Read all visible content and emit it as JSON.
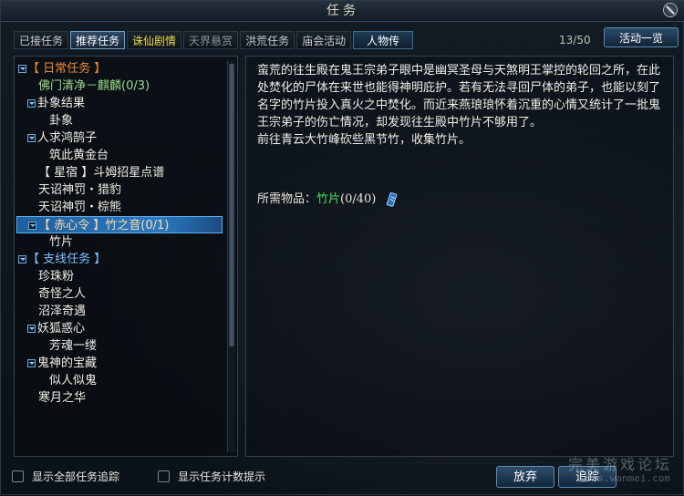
{
  "window": {
    "title": "任务"
  },
  "tabs": [
    {
      "label": "已接任务",
      "state": "normal"
    },
    {
      "label": "推荐任务",
      "state": "active"
    },
    {
      "label": "诛仙剧情",
      "state": "gold"
    },
    {
      "label": "天界悬赏",
      "state": "dim"
    },
    {
      "label": "洪荒任务",
      "state": "normal"
    },
    {
      "label": "庙会活动",
      "state": "normal"
    },
    {
      "label": "人物传",
      "state": "highlight"
    }
  ],
  "counter": "13/50",
  "activity_button": "活动一览",
  "tree": [
    {
      "label": "【 日常任务 】",
      "level": 0,
      "toggle": true,
      "color": "orange"
    },
    {
      "label": "佛门清净－麒麟(0/3)",
      "level": 1,
      "toggle": false,
      "color": "green"
    },
    {
      "label": "卦象结果",
      "level": 1,
      "toggle": true,
      "color": "white"
    },
    {
      "label": "卦象",
      "level": 2,
      "toggle": false,
      "color": "white"
    },
    {
      "label": "人求鸿鹄子",
      "level": 1,
      "toggle": true,
      "color": "white"
    },
    {
      "label": "筑此黄金台",
      "level": 2,
      "toggle": false,
      "color": "white"
    },
    {
      "label": "【 星宿 】斗姆招星点谱",
      "level": 1,
      "toggle": false,
      "color": "white"
    },
    {
      "label": "天诏神罚・猎豹",
      "level": 1,
      "toggle": false,
      "color": "white"
    },
    {
      "label": "天诏神罚・棕熊",
      "level": 1,
      "toggle": false,
      "color": "white"
    },
    {
      "label": "【 赤心令 】竹之音(0/1)",
      "level": 1,
      "toggle": true,
      "color": "selected",
      "selected": true
    },
    {
      "label": "竹片",
      "level": 2,
      "toggle": false,
      "color": "white"
    },
    {
      "label": "【 支线任务 】",
      "level": 0,
      "toggle": true,
      "color": "blue"
    },
    {
      "label": "珍珠粉",
      "level": 1,
      "toggle": false,
      "color": "white"
    },
    {
      "label": "奇怪之人",
      "level": 1,
      "toggle": false,
      "color": "white"
    },
    {
      "label": "沼泽奇遇",
      "level": 1,
      "toggle": false,
      "color": "white"
    },
    {
      "label": "妖狐惑心",
      "level": 1,
      "toggle": true,
      "color": "white"
    },
    {
      "label": "芳魂一缕",
      "level": 2,
      "toggle": false,
      "color": "white"
    },
    {
      "label": "鬼神的宝藏",
      "level": 1,
      "toggle": true,
      "color": "white"
    },
    {
      "label": "似人似鬼",
      "level": 2,
      "toggle": false,
      "color": "white"
    },
    {
      "label": "寒月之华",
      "level": 1,
      "toggle": false,
      "color": "white"
    }
  ],
  "detail": {
    "description": "蛮荒的往生殿在鬼王宗弟子眼中是幽冥圣母与天煞明王掌控的轮回之所，在此处焚化的尸体在来世也能得神明庇护。若有无法寻回尸体的弟子，也能以刻了名字的竹片投入真火之中焚化。而近来燕琅琅怀着沉重的心情又统计了一批鬼王宗弟子的伤亡情况，却发现往生殿中竹片不够用了。\n前往青云大竹峰砍些黑节竹，收集竹片。",
    "required_label": "所需物品：",
    "required_item": "竹片",
    "required_count": "(0/40)"
  },
  "footer": {
    "show_all_label": "显示全部任务追踪",
    "show_count_label": "显示任务计数提示",
    "abandon_button": "放弃",
    "track_button": "追踪"
  },
  "watermark": {
    "line1": "完美游戏论坛",
    "line2": "bbs.wanmei.com"
  },
  "colors": {
    "orange": "#f08a36",
    "green": "#9cd88a",
    "white": "#f0eee6",
    "blue": "#7ec0ff",
    "selected": "#ffdca0",
    "item_green": "#47e05a",
    "selection_bg": "#2d79c2"
  },
  "icons": {
    "close": "close-icon",
    "bamboo": "bamboo-slip-icon",
    "toggle": "collapse-toggle-icon"
  }
}
